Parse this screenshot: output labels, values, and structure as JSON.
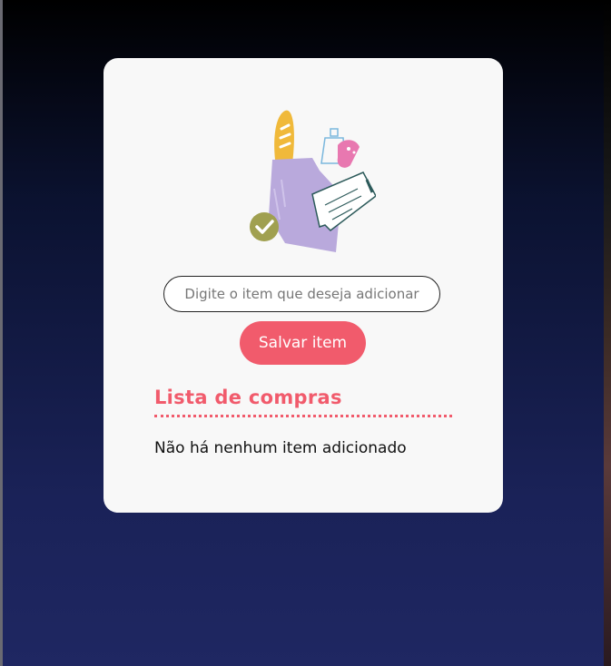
{
  "input": {
    "placeholder": "Digite o item que deseja adicionar",
    "value": ""
  },
  "save_button": {
    "label": "Salvar item"
  },
  "list": {
    "title": "Lista de compras",
    "empty_message": "Não há nenhum item adicionado",
    "items": []
  },
  "illustration": {
    "icons": [
      "shopping-bag-icon",
      "bread-icon",
      "bottle-icon",
      "sausage-icon",
      "receipt-icon",
      "check-icon"
    ]
  },
  "colors": {
    "accent": "#f15b6c",
    "card_background": "#f8f8f8",
    "bag": "#b9a9dc",
    "bread": "#f0b93a",
    "check_badge": "#a0a050"
  }
}
